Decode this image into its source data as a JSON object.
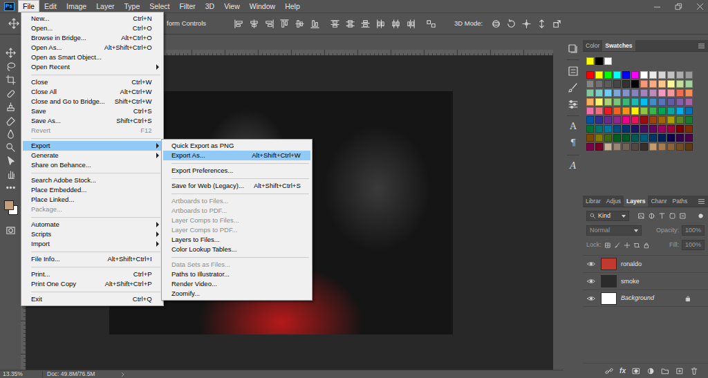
{
  "app": {
    "logo": "Ps"
  },
  "menubar": [
    {
      "label": "File",
      "selected": true
    },
    {
      "label": "Edit",
      "selected": false
    },
    {
      "label": "Image",
      "selected": false
    },
    {
      "label": "Layer",
      "selected": false
    },
    {
      "label": "Type",
      "selected": false
    },
    {
      "label": "Select",
      "selected": false
    },
    {
      "label": "Filter",
      "selected": false
    },
    {
      "label": "3D",
      "selected": false
    },
    {
      "label": "View",
      "selected": false
    },
    {
      "label": "Window",
      "selected": false
    },
    {
      "label": "Help",
      "selected": false
    }
  ],
  "options_bar": {
    "transform_label": "form Controls",
    "mode_label": "3D Mode:"
  },
  "file_menu": {
    "items": [
      {
        "kind": "item",
        "label": "New...",
        "shortcut": "Ctrl+N",
        "selected": false,
        "disabled": false,
        "submenu": false
      },
      {
        "kind": "item",
        "label": "Open...",
        "shortcut": "Ctrl+O",
        "selected": false,
        "disabled": false,
        "submenu": false
      },
      {
        "kind": "item",
        "label": "Browse in Bridge...",
        "shortcut": "Alt+Ctrl+O",
        "selected": false,
        "disabled": false,
        "submenu": false
      },
      {
        "kind": "item",
        "label": "Open As...",
        "shortcut": "Alt+Shift+Ctrl+O",
        "selected": false,
        "disabled": false,
        "submenu": false
      },
      {
        "kind": "item",
        "label": "Open as Smart Object...",
        "selected": false,
        "disabled": false,
        "submenu": false
      },
      {
        "kind": "item",
        "label": "Open Recent",
        "selected": false,
        "disabled": false,
        "submenu": true
      },
      {
        "kind": "separator"
      },
      {
        "kind": "item",
        "label": "Close",
        "shortcut": "Ctrl+W",
        "selected": false,
        "disabled": false,
        "submenu": false
      },
      {
        "kind": "item",
        "label": "Close All",
        "shortcut": "Alt+Ctrl+W",
        "selected": false,
        "disabled": false,
        "submenu": false
      },
      {
        "kind": "item",
        "label": "Close and Go to Bridge...",
        "shortcut": "Shift+Ctrl+W",
        "selected": false,
        "disabled": false,
        "submenu": false
      },
      {
        "kind": "item",
        "label": "Save",
        "shortcut": "Ctrl+S",
        "selected": false,
        "disabled": false,
        "submenu": false
      },
      {
        "kind": "item",
        "label": "Save As...",
        "shortcut": "Shift+Ctrl+S",
        "selected": false,
        "disabled": false,
        "submenu": false
      },
      {
        "kind": "item",
        "label": "Revert",
        "shortcut": "F12",
        "selected": false,
        "disabled": true,
        "submenu": false
      },
      {
        "kind": "separator"
      },
      {
        "kind": "item",
        "label": "Export",
        "selected": true,
        "disabled": false,
        "submenu": true
      },
      {
        "kind": "item",
        "label": "Generate",
        "selected": false,
        "disabled": false,
        "submenu": true
      },
      {
        "kind": "item",
        "label": "Share on Behance...",
        "selected": false,
        "disabled": false,
        "submenu": false
      },
      {
        "kind": "separator"
      },
      {
        "kind": "item",
        "label": "Search Adobe Stock...",
        "selected": false,
        "disabled": false,
        "submenu": false
      },
      {
        "kind": "item",
        "label": "Place Embedded...",
        "selected": false,
        "disabled": false,
        "submenu": false
      },
      {
        "kind": "item",
        "label": "Place Linked...",
        "selected": false,
        "disabled": false,
        "submenu": false
      },
      {
        "kind": "item",
        "label": "Package...",
        "selected": false,
        "disabled": true,
        "submenu": false
      },
      {
        "kind": "separator"
      },
      {
        "kind": "item",
        "label": "Automate",
        "selected": false,
        "disabled": false,
        "submenu": true
      },
      {
        "kind": "item",
        "label": "Scripts",
        "selected": false,
        "disabled": false,
        "submenu": true
      },
      {
        "kind": "item",
        "label": "Import",
        "selected": false,
        "disabled": false,
        "submenu": true
      },
      {
        "kind": "separator"
      },
      {
        "kind": "item",
        "label": "File Info...",
        "shortcut": "Alt+Shift+Ctrl+I",
        "selected": false,
        "disabled": false,
        "submenu": false
      },
      {
        "kind": "separator"
      },
      {
        "kind": "item",
        "label": "Print...",
        "shortcut": "Ctrl+P",
        "selected": false,
        "disabled": false,
        "submenu": false
      },
      {
        "kind": "item",
        "label": "Print One Copy",
        "shortcut": "Alt+Shift+Ctrl+P",
        "selected": false,
        "disabled": false,
        "submenu": false
      },
      {
        "kind": "separator"
      },
      {
        "kind": "item",
        "label": "Exit",
        "shortcut": "Ctrl+Q",
        "selected": false,
        "disabled": false,
        "submenu": false
      }
    ]
  },
  "export_submenu": {
    "items": [
      {
        "kind": "item",
        "label": "Quick Export as PNG",
        "selected": false,
        "disabled": false,
        "submenu": false
      },
      {
        "kind": "item",
        "label": "Export As...",
        "shortcut": "Alt+Shift+Ctrl+W",
        "selected": true,
        "disabled": false,
        "submenu": false
      },
      {
        "kind": "separator"
      },
      {
        "kind": "item",
        "label": "Export Preferences...",
        "selected": false,
        "disabled": false,
        "submenu": false
      },
      {
        "kind": "separator"
      },
      {
        "kind": "item",
        "label": "Save for Web (Legacy)...",
        "shortcut": "Alt+Shift+Ctrl+S",
        "selected": false,
        "disabled": false,
        "submenu": false
      },
      {
        "kind": "separator"
      },
      {
        "kind": "item",
        "label": "Artboards to Files...",
        "selected": false,
        "disabled": true,
        "submenu": false
      },
      {
        "kind": "item",
        "label": "Artboards to PDF...",
        "selected": false,
        "disabled": true,
        "submenu": false
      },
      {
        "kind": "item",
        "label": "Layer Comps to Files...",
        "selected": false,
        "disabled": true,
        "submenu": false
      },
      {
        "kind": "item",
        "label": "Layer Comps to PDF...",
        "selected": false,
        "disabled": true,
        "submenu": false
      },
      {
        "kind": "item",
        "label": "Layers to Files...",
        "selected": false,
        "disabled": false,
        "submenu": false
      },
      {
        "kind": "item",
        "label": "Color Lookup Tables...",
        "selected": false,
        "disabled": false,
        "submenu": false
      },
      {
        "kind": "separator"
      },
      {
        "kind": "item",
        "label": "Data Sets as Files...",
        "selected": false,
        "disabled": true,
        "submenu": false
      },
      {
        "kind": "item",
        "label": "Paths to Illustrator...",
        "selected": false,
        "disabled": false,
        "submenu": false
      },
      {
        "kind": "item",
        "label": "Render Video...",
        "selected": false,
        "disabled": false,
        "submenu": false
      },
      {
        "kind": "item",
        "label": "Zoomify...",
        "selected": false,
        "disabled": false,
        "submenu": false
      }
    ]
  },
  "tools": {
    "foreground": "#c4a07a",
    "background": "#ffffff"
  },
  "icon_strip": {
    "glyphs": [
      "A",
      "¶",
      "A"
    ]
  },
  "color_panel": {
    "tabs": [
      {
        "label": "Color",
        "selected": false
      },
      {
        "label": "Swatches",
        "selected": true
      }
    ],
    "recent": [
      "#ffff00",
      "#000000",
      "#ffffff"
    ],
    "swatches": [
      "#ff0000",
      "#ffff00",
      "#00ff00",
      "#00ffff",
      "#0000ff",
      "#ff00ff",
      "#ffffff",
      "#ebebeb",
      "#d6d6d6",
      "#c2c2c2",
      "#adadad",
      "#999999",
      "#858585",
      "#707070",
      "#5c5c5c",
      "#474747",
      "#333333",
      "#000000",
      "#f7977a",
      "#f9ad81",
      "#fdc68a",
      "#fff79a",
      "#c4df9b",
      "#a3d39c",
      "#82ca9d",
      "#7accc8",
      "#6dcff6",
      "#7da7d9",
      "#8393ca",
      "#8781bd",
      "#a186be",
      "#bd8cbf",
      "#f49ac2",
      "#f6989d",
      "#f26c4f",
      "#f68e55",
      "#fbaf5c",
      "#fff467",
      "#acd372",
      "#7cc576",
      "#3bb878",
      "#1abbb4",
      "#00bff3",
      "#438cca",
      "#5574b9",
      "#605ca8",
      "#855fa8",
      "#a763a8",
      "#f06eaa",
      "#f26d7d",
      "#ed1c24",
      "#f26522",
      "#f7941d",
      "#fff200",
      "#8dc73f",
      "#39b54a",
      "#00a651",
      "#00a99d",
      "#00aeef",
      "#0072bc",
      "#0054a6",
      "#2e3192",
      "#662d91",
      "#92278f",
      "#ec008c",
      "#ed145b",
      "#9e0b0f",
      "#a0410d",
      "#a36209",
      "#aba000",
      "#598527",
      "#197b30",
      "#007236",
      "#00746b",
      "#0076a3",
      "#004b80",
      "#003471",
      "#1b1464",
      "#440e62",
      "#630460",
      "#9e005d",
      "#9e0039",
      "#790000",
      "#7b2e00",
      "#7d4900",
      "#827b00",
      "#406618",
      "#005e20",
      "#005826",
      "#005952",
      "#005b7f",
      "#003663",
      "#002157",
      "#0d004c",
      "#32004b",
      "#4b0049",
      "#7b0046",
      "#7a0026",
      "#c7b299",
      "#998675",
      "#736357",
      "#534741",
      "#37302a",
      "#c69c6d",
      "#a67c52",
      "#8c6239",
      "#754c24",
      "#603913"
    ]
  },
  "layers_panel": {
    "tabs": [
      {
        "label": "Librar",
        "selected": false
      },
      {
        "label": "Adjus",
        "selected": false
      },
      {
        "label": "Layers",
        "selected": true
      },
      {
        "label": "Chanr",
        "selected": false
      },
      {
        "label": "Paths",
        "selected": false
      }
    ],
    "filter": {
      "label": "Kind"
    },
    "blend": {
      "mode": "Normal",
      "disabled": true
    },
    "opacity": {
      "label": "Opacity:",
      "value": "100%",
      "disabled": true
    },
    "lock": {
      "label": "Lock:"
    },
    "fill": {
      "label": "Fill:",
      "value": "100%",
      "disabled": true
    },
    "layers": [
      {
        "name": "ronaldo",
        "kind": "layer",
        "visible": true,
        "locked": false,
        "color": "#c23a2e"
      },
      {
        "name": "smoke",
        "kind": "layer",
        "visible": true,
        "locked": false,
        "color": "#2b2b2b"
      },
      {
        "name": "Background",
        "kind": "background",
        "visible": true,
        "locked": true,
        "color": "#ffffff"
      }
    ],
    "footer": {
      "fx": "fx"
    }
  },
  "status_bar": {
    "zoom": "13.35%",
    "doc": "Doc: 49.8M/76.5M"
  }
}
